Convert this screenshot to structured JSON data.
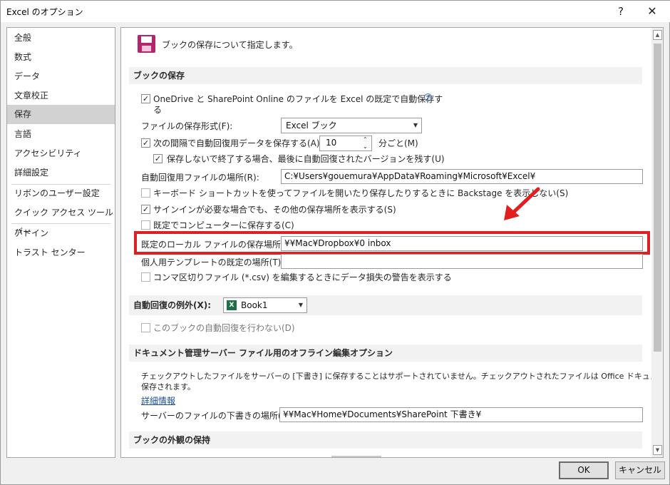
{
  "window": {
    "title": "Excel のオプション",
    "help": "?",
    "close": "✕"
  },
  "nav": {
    "items": [
      "全般",
      "数式",
      "データ",
      "文章校正",
      "保存",
      "言語",
      "アクセシビリティ",
      "詳細設定",
      "リボンのユーザー設定",
      "クイック アクセス ツール バー",
      "アドイン",
      "トラスト センター"
    ],
    "selected": "保存"
  },
  "header": {
    "text": "ブックの保存について指定します。"
  },
  "sections": {
    "save_books": "ブックの保存",
    "autorecover_exceptions": "自動回復の例外(X):",
    "offline_editing": "ドキュメント管理サーバー ファイル用のオフライン編集オプション",
    "visual_appearance": "ブックの外観の保持"
  },
  "save": {
    "autosave_onedrive_line1": "OneDrive と SharePoint Online のファイルを Excel の既定で自動保存す",
    "autosave_onedrive_line2": "る",
    "file_format_label": "ファイルの保存形式(F):",
    "file_format_value": "Excel ブック",
    "autorecover_interval_label": "次の間隔で自動回復用データを保存する(A):",
    "autorecover_interval_value": "10",
    "autorecover_interval_unit": "分ごと(M)",
    "keep_last_autosaved": "保存しないで終了する場合、最後に自動回復されたバージョンを残す(U)",
    "autorecover_location_label": "自動回復用ファイルの場所(R):",
    "autorecover_location_value": "C:¥Users¥gouemura¥AppData¥Roaming¥Microsoft¥Excel¥",
    "no_backstage": "キーボード ショートカットを使ってファイルを開いたり保存したりするときに Backstage を表示しない(S)",
    "show_additional_places": "サインインが必要な場合でも、その他の保存場所を表示する(S)",
    "save_to_computer": "既定でコンピューターに保存する(C)",
    "default_local_label": "既定のローカル ファイルの保存場所(I):",
    "default_local_value": "¥¥Mac¥Dropbox¥0 inbox",
    "personal_templates_label": "個人用テンプレートの既定の場所(T):",
    "personal_templates_value": "",
    "csv_warning": "コンマ区切りファイル (*.csv) を編集するときにデータ損失の警告を表示する"
  },
  "exceptions": {
    "workbook_value": "Book1",
    "disable_autorecover": "このブックの自動回復を行わない(D)"
  },
  "offline": {
    "description_line1": "チェックアウトしたファイルをサーバーの [下書き] に保存することはサポートされていません。チェックアウトされたファイルは Office ドキュメント キャッシュに",
    "description_line2": "保存されます。",
    "more_info": "詳細情報",
    "drafts_label": "サーバーのファイルの下書きの場所(V):",
    "drafts_value": "¥¥Mac¥Home¥Documents¥SharePoint 下書き¥"
  },
  "buttons": {
    "ok": "OK",
    "cancel": "キャンセル"
  },
  "checkbox_states": {
    "autosave_onedrive": true,
    "autorecover_interval": true,
    "keep_last_autosaved": true,
    "no_backstage": false,
    "show_additional_places": true,
    "save_to_computer": false,
    "csv_warning": false,
    "disable_autorecover": false
  },
  "colors": {
    "highlight_box": "#e02020",
    "annotation_arrow": "#e02020",
    "selected_nav": "#d2d2d2",
    "excel_green": "#1e7145"
  },
  "icons": {
    "header": "save-floppy-icon",
    "info": "info-icon",
    "workbook": "excel-file-icon"
  }
}
